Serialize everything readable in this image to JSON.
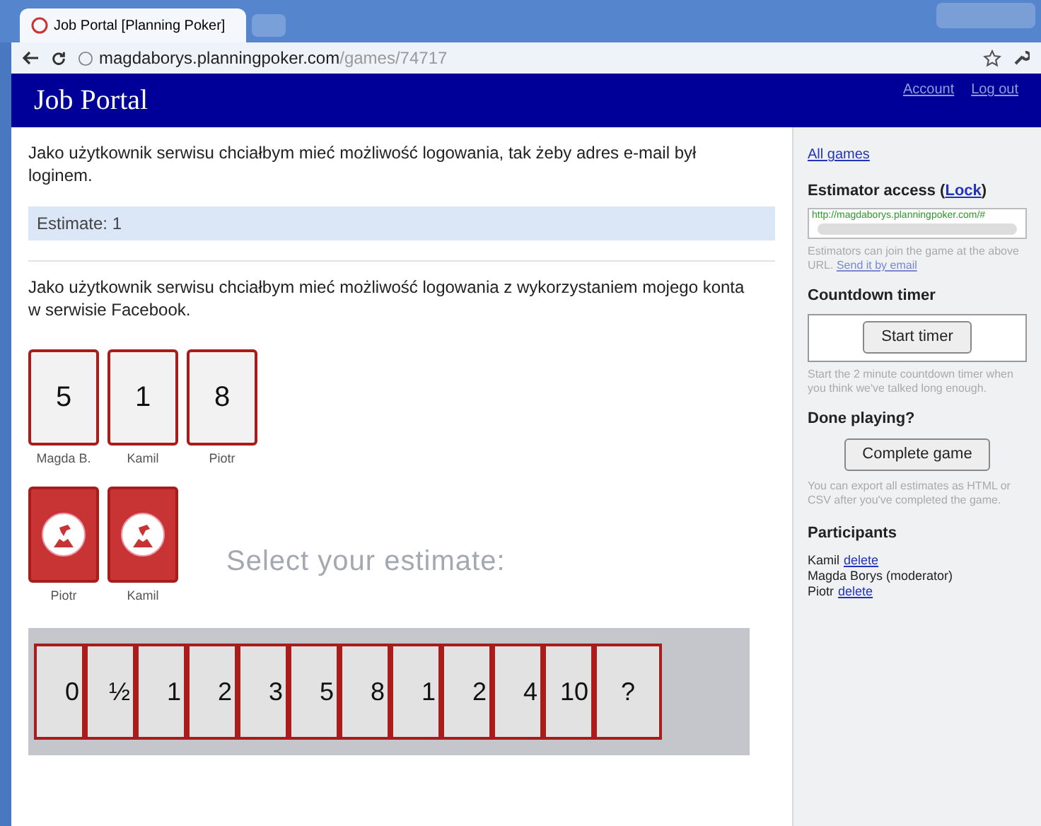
{
  "browser": {
    "tab_title": "Job Portal [Planning Poker]",
    "url_host": "magdaborys.planningpoker.com",
    "url_path": "/games/74717"
  },
  "header": {
    "title": "Job Portal",
    "links": [
      "Account",
      "Log out"
    ]
  },
  "stories": [
    {
      "text": "Jako użytkownik serwisu chciałbym mieć możliwość logowania, tak żeby adres e-mail był loginem.",
      "estimate": "Estimate: 1"
    },
    {
      "text": "Jako użytkownik serwisu chciałbym mieć możliwość logowania z wykorzystaniem mojego konta w serwisie Facebook."
    }
  ],
  "votes": [
    {
      "value": "5",
      "name": "Magda B.",
      "revealed": true
    },
    {
      "value": "1",
      "name": "Kamil",
      "revealed": true
    },
    {
      "value": "8",
      "name": "Piotr",
      "revealed": true
    }
  ],
  "pending": [
    {
      "name": "Piotr",
      "revealed": false
    },
    {
      "name": "Kamil",
      "revealed": false
    }
  ],
  "select_prompt": "Select your estimate:",
  "deck": [
    {
      "label": "0"
    },
    {
      "label": "½"
    },
    {
      "label": "1"
    },
    {
      "label": "2"
    },
    {
      "label": "3"
    },
    {
      "label": "5"
    },
    {
      "label": "8"
    },
    {
      "label": "1"
    },
    {
      "label": "2"
    },
    {
      "label": "4"
    },
    {
      "label": "10"
    },
    {
      "label": "?"
    }
  ],
  "sidebar": {
    "all_games": "All games",
    "access_heading": "Estimator access (",
    "lock": "Lock",
    "access_heading_end": ")",
    "access_url": "http://magdaborys.planningpoker.com/#",
    "access_note": "Estimators can join the game at the above URL.",
    "send_link": "Send it by email",
    "timer_heading": "Countdown timer",
    "timer_button": "Start timer",
    "timer_note": "Start the 2 minute countdown timer when you think we've talked long enough.",
    "done_heading": "Done playing?",
    "complete_button": "Complete game",
    "done_note": "You can export all estimates as HTML or CSV after you've completed the game.",
    "participants_heading": "Participants",
    "participants": [
      {
        "name": "Kamil",
        "delete": "delete"
      },
      {
        "name": "Magda Borys (moderator)"
      },
      {
        "name": "Piotr",
        "delete": "delete"
      }
    ]
  }
}
